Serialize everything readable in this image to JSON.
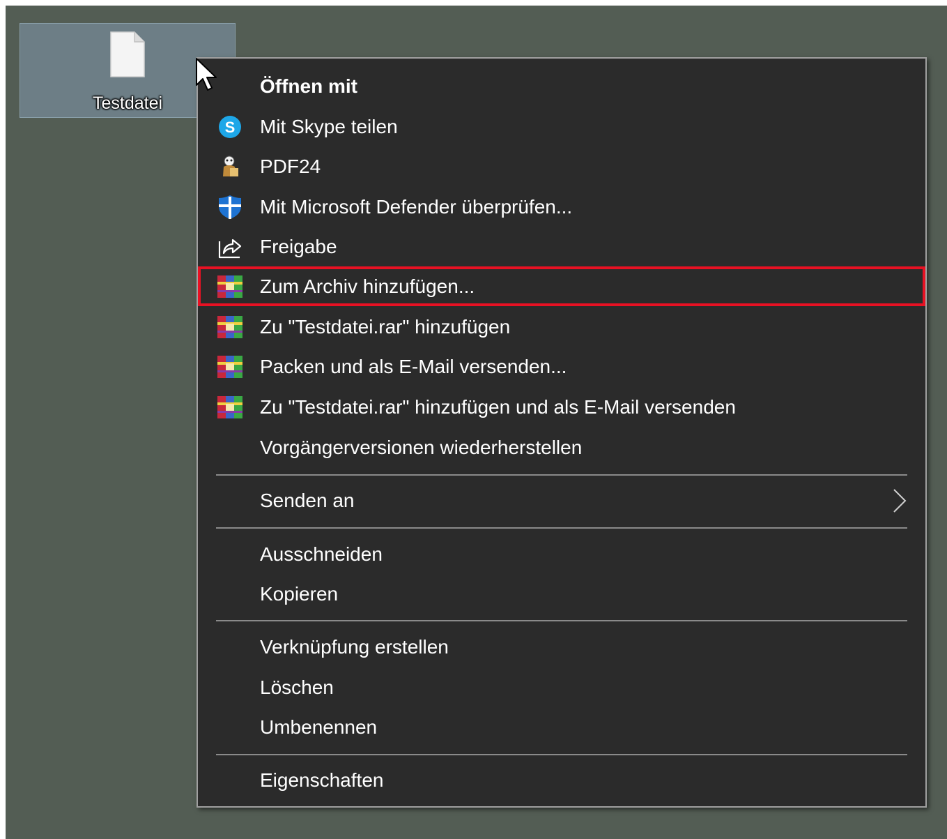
{
  "desktop": {
    "file_name": "Testdatei"
  },
  "context_menu": {
    "items": [
      {
        "label": "Öffnen mit",
        "icon": "none",
        "bold": true
      },
      {
        "label": "Mit Skype teilen",
        "icon": "skype-icon"
      },
      {
        "label": "PDF24",
        "icon": "pdf24-icon"
      },
      {
        "label": "Mit Microsoft Defender überprüfen...",
        "icon": "defender-shield-icon"
      },
      {
        "label": "Freigabe",
        "icon": "share-icon"
      },
      {
        "label": "Zum Archiv hinzufügen...",
        "icon": "winrar-icon",
        "highlighted": true
      },
      {
        "label": "Zu \"Testdatei.rar\" hinzufügen",
        "icon": "winrar-icon"
      },
      {
        "label": "Packen und als E-Mail versenden...",
        "icon": "winrar-icon"
      },
      {
        "label": "Zu \"Testdatei.rar\" hinzufügen und als E-Mail versenden",
        "icon": "winrar-icon"
      },
      {
        "label": "Vorgängerversionen wiederherstellen",
        "icon": "none"
      },
      {
        "label": "Senden an",
        "icon": "none",
        "submenu": true
      },
      {
        "label": "Ausschneiden",
        "icon": "none"
      },
      {
        "label": "Kopieren",
        "icon": "none"
      },
      {
        "label": "Verknüpfung erstellen",
        "icon": "none"
      },
      {
        "label": "Löschen",
        "icon": "none"
      },
      {
        "label": "Umbenennen",
        "icon": "none"
      },
      {
        "label": "Eigenschaften",
        "icon": "none"
      }
    ]
  },
  "colors": {
    "desktop_bg": "#535d54",
    "menu_bg": "#2b2b2b",
    "highlight_border": "#e81123",
    "selection_bg": "#6d7e86"
  }
}
